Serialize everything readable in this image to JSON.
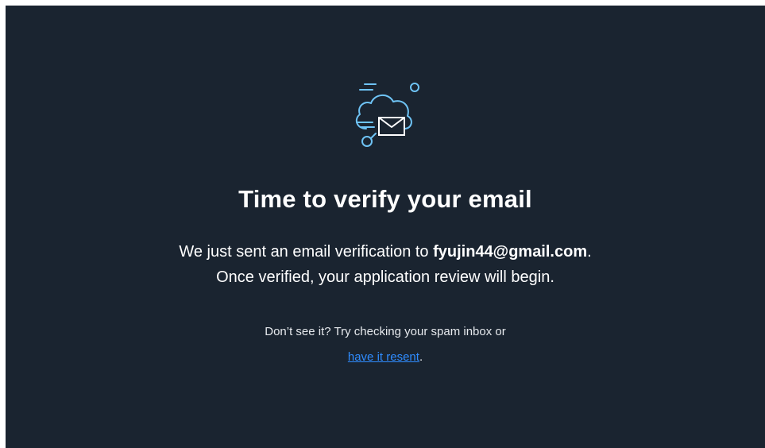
{
  "icon": {
    "name": "cloud-email-icon",
    "stroke_color": "#6ec3f5",
    "envelope_color": "#ffffff"
  },
  "verify": {
    "title": "Time to verify your email",
    "line1_prefix": "We just sent an email verification to ",
    "email": "fyujin44@gmail.com",
    "line1_suffix": ".",
    "line2": "Once verified, your application review will begin.",
    "hint": "Don’t see it? Try checking your spam inbox or",
    "resend_link": "have it resent",
    "resend_suffix": "."
  },
  "colors": {
    "background": "#1a2430",
    "link": "#2f8cff",
    "text": "#ffffff"
  }
}
